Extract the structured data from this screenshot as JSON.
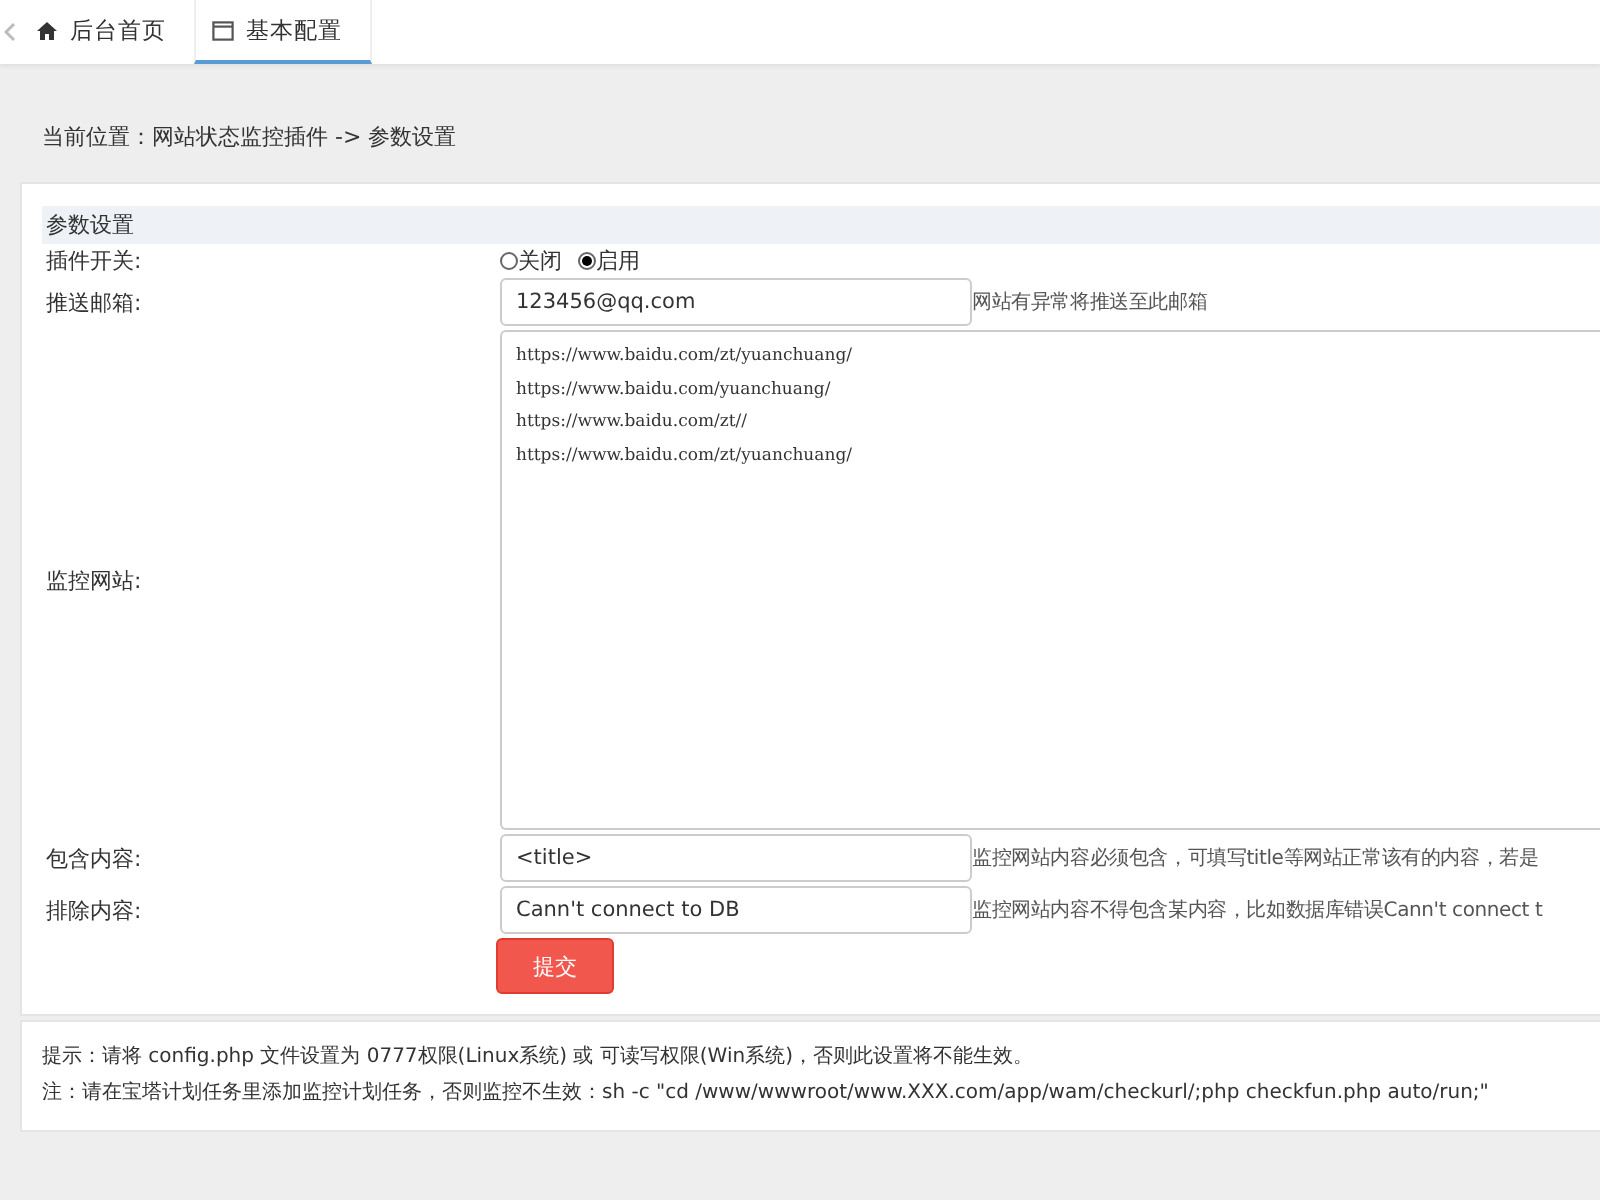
{
  "tabs": [
    {
      "label": "后台首页",
      "selected": false
    },
    {
      "label": "基本配置",
      "selected": true
    }
  ],
  "breadcrumb": "当前位置：网站状态监控插件 -> 参数设置",
  "form": {
    "title": "参数设置",
    "rows": [
      {
        "kind": "radio",
        "label": "插件开关:",
        "options": [
          {
            "label": "关闭",
            "selected": false
          },
          {
            "label": "启用",
            "selected": true
          }
        ]
      },
      {
        "kind": "input",
        "label": "推送邮箱:",
        "value": "123456@qq.com",
        "hint": "网站有异常将推送至此邮箱"
      },
      {
        "kind": "textarea",
        "label": "监控网站:",
        "lines": [
          "https://www.baidu.com/zt/yuanchuang/",
          "https://www.baidu.com/yuanchuang/",
          "https://www.baidu.com/zt//",
          "https://www.baidu.com/zt/yuanchuang/"
        ]
      },
      {
        "kind": "input",
        "label": "包含内容:",
        "value": "<title>",
        "hint": "监控网站内容必须包含，可填写title等网站正常该有的内容，若是"
      },
      {
        "kind": "input",
        "label": "排除内容:",
        "value": "Cann't connect to DB",
        "hint": "监控网站内容不得包含某内容，比如数据库错误Cann't connect t"
      }
    ],
    "submit": "提交"
  },
  "notes": [
    "提示：请将 config.php 文件设置为 0777权限(Linux系统) 或 可读写权限(Win系统)，否则此设置将不能生效。",
    "注：请在宝塔计划任务里添加监控计划任务，否则监控不生效：sh -c \"cd /www/wwwroot/www.XXX.com/app/wam/checkurl/;php checkfun.php auto/run;\""
  ]
}
